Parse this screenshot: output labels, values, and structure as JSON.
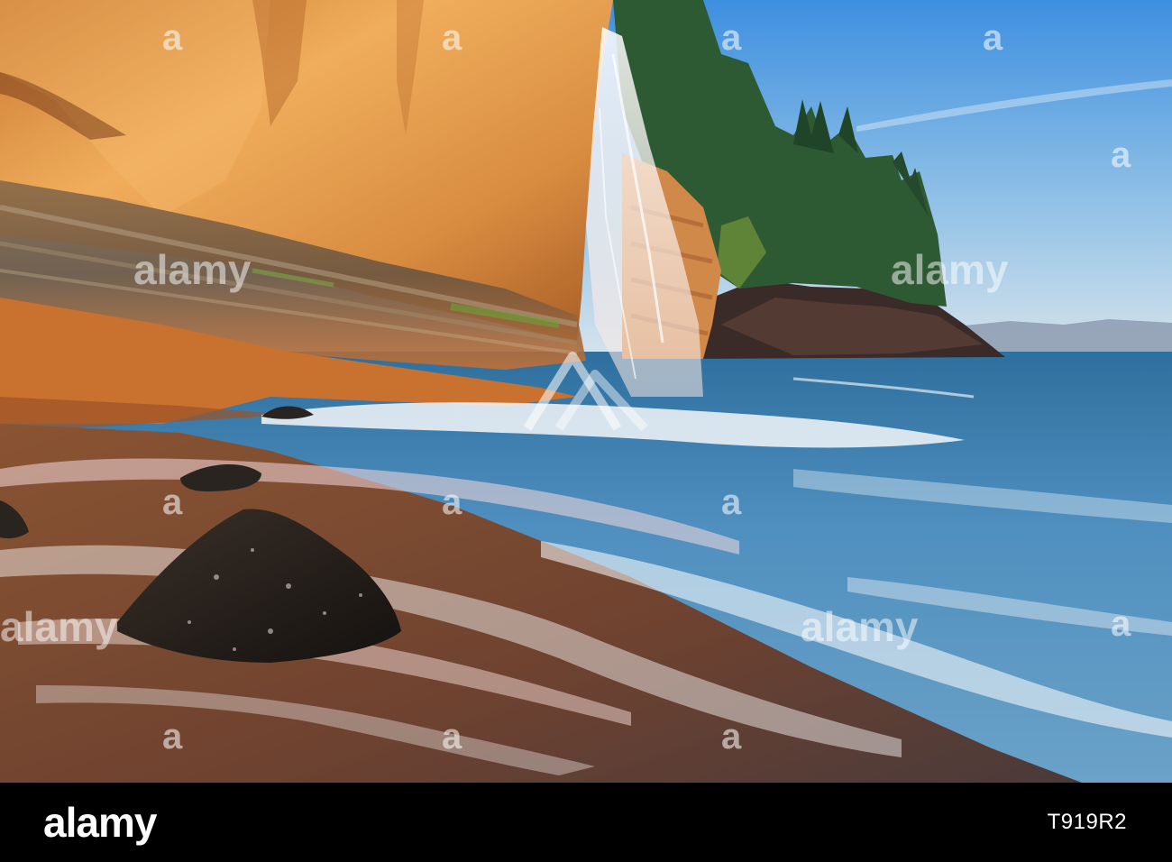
{
  "watermark": {
    "brand": "alamy",
    "tile_mark": "a"
  },
  "footer": {
    "brand": "alamy",
    "image_id": "T919R2"
  },
  "colors": {
    "cliff": "#d98b3c",
    "cliff_highlight": "#f2b25f",
    "sky_top": "#3d8fe0",
    "sky_bottom": "#cfe3f0",
    "ocean": "#3f7fb0",
    "sand": "#7a4a2a",
    "footer_bg": "#000000"
  }
}
